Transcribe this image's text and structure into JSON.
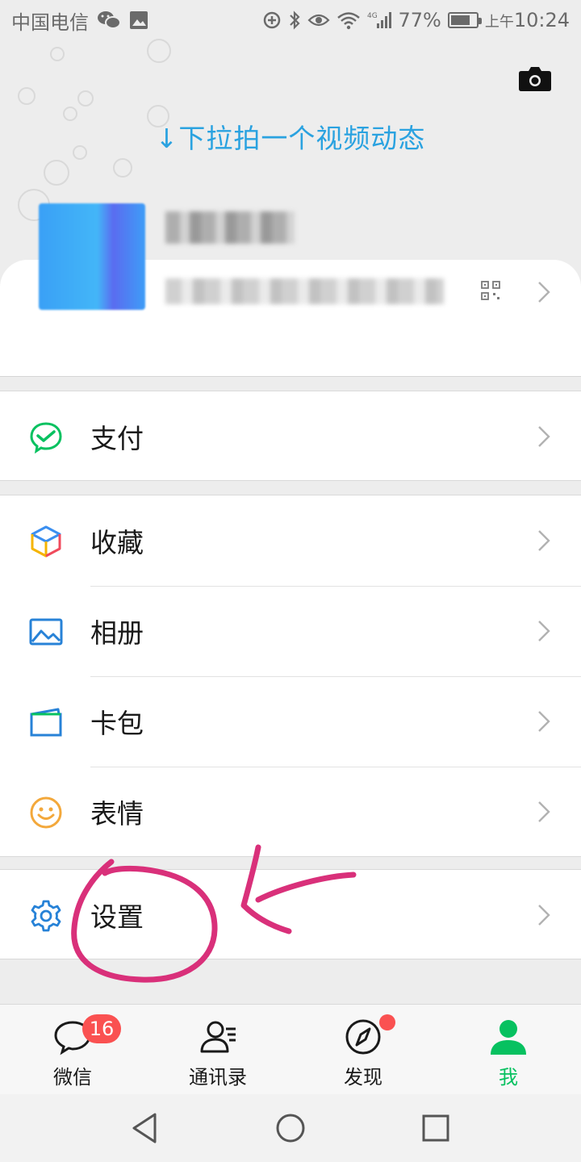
{
  "status_bar": {
    "carrier": "中国电信",
    "battery": "77%",
    "battery_level": 0.77,
    "time_prefix": "上午",
    "time": "10:24",
    "network": "4G"
  },
  "header": {
    "pull_hint": "↓下拉拍一个视频动态",
    "camera_icon": "camera-icon"
  },
  "profile": {
    "avatar_icon": "avatar",
    "qr_icon": "qr-code-icon"
  },
  "menu": {
    "pay": {
      "label": "支付",
      "icon": "wechat-pay-icon",
      "color": "#07c160"
    },
    "favorites": {
      "label": "收藏",
      "icon": "cube-icon"
    },
    "album": {
      "label": "相册",
      "icon": "picture-icon",
      "color": "#2782d7"
    },
    "cards": {
      "label": "卡包",
      "icon": "wallet-icon",
      "color": "#2782d7"
    },
    "stickers": {
      "label": "表情",
      "icon": "smiley-icon",
      "color": "#f3a83b"
    },
    "settings": {
      "label": "设置",
      "icon": "gear-icon",
      "color": "#2782d7"
    }
  },
  "tabs": [
    {
      "label": "微信",
      "icon": "chat-bubble-icon",
      "badge": "16"
    },
    {
      "label": "通讯录",
      "icon": "contacts-icon"
    },
    {
      "label": "发现",
      "icon": "compass-icon",
      "dot": true
    },
    {
      "label": "我",
      "icon": "person-icon",
      "active": true
    }
  ],
  "colors": {
    "accent_green": "#07c160",
    "hint_blue": "#2aa2e0",
    "badge_red": "#fa5151",
    "annotation_pink": "#d9307a"
  }
}
